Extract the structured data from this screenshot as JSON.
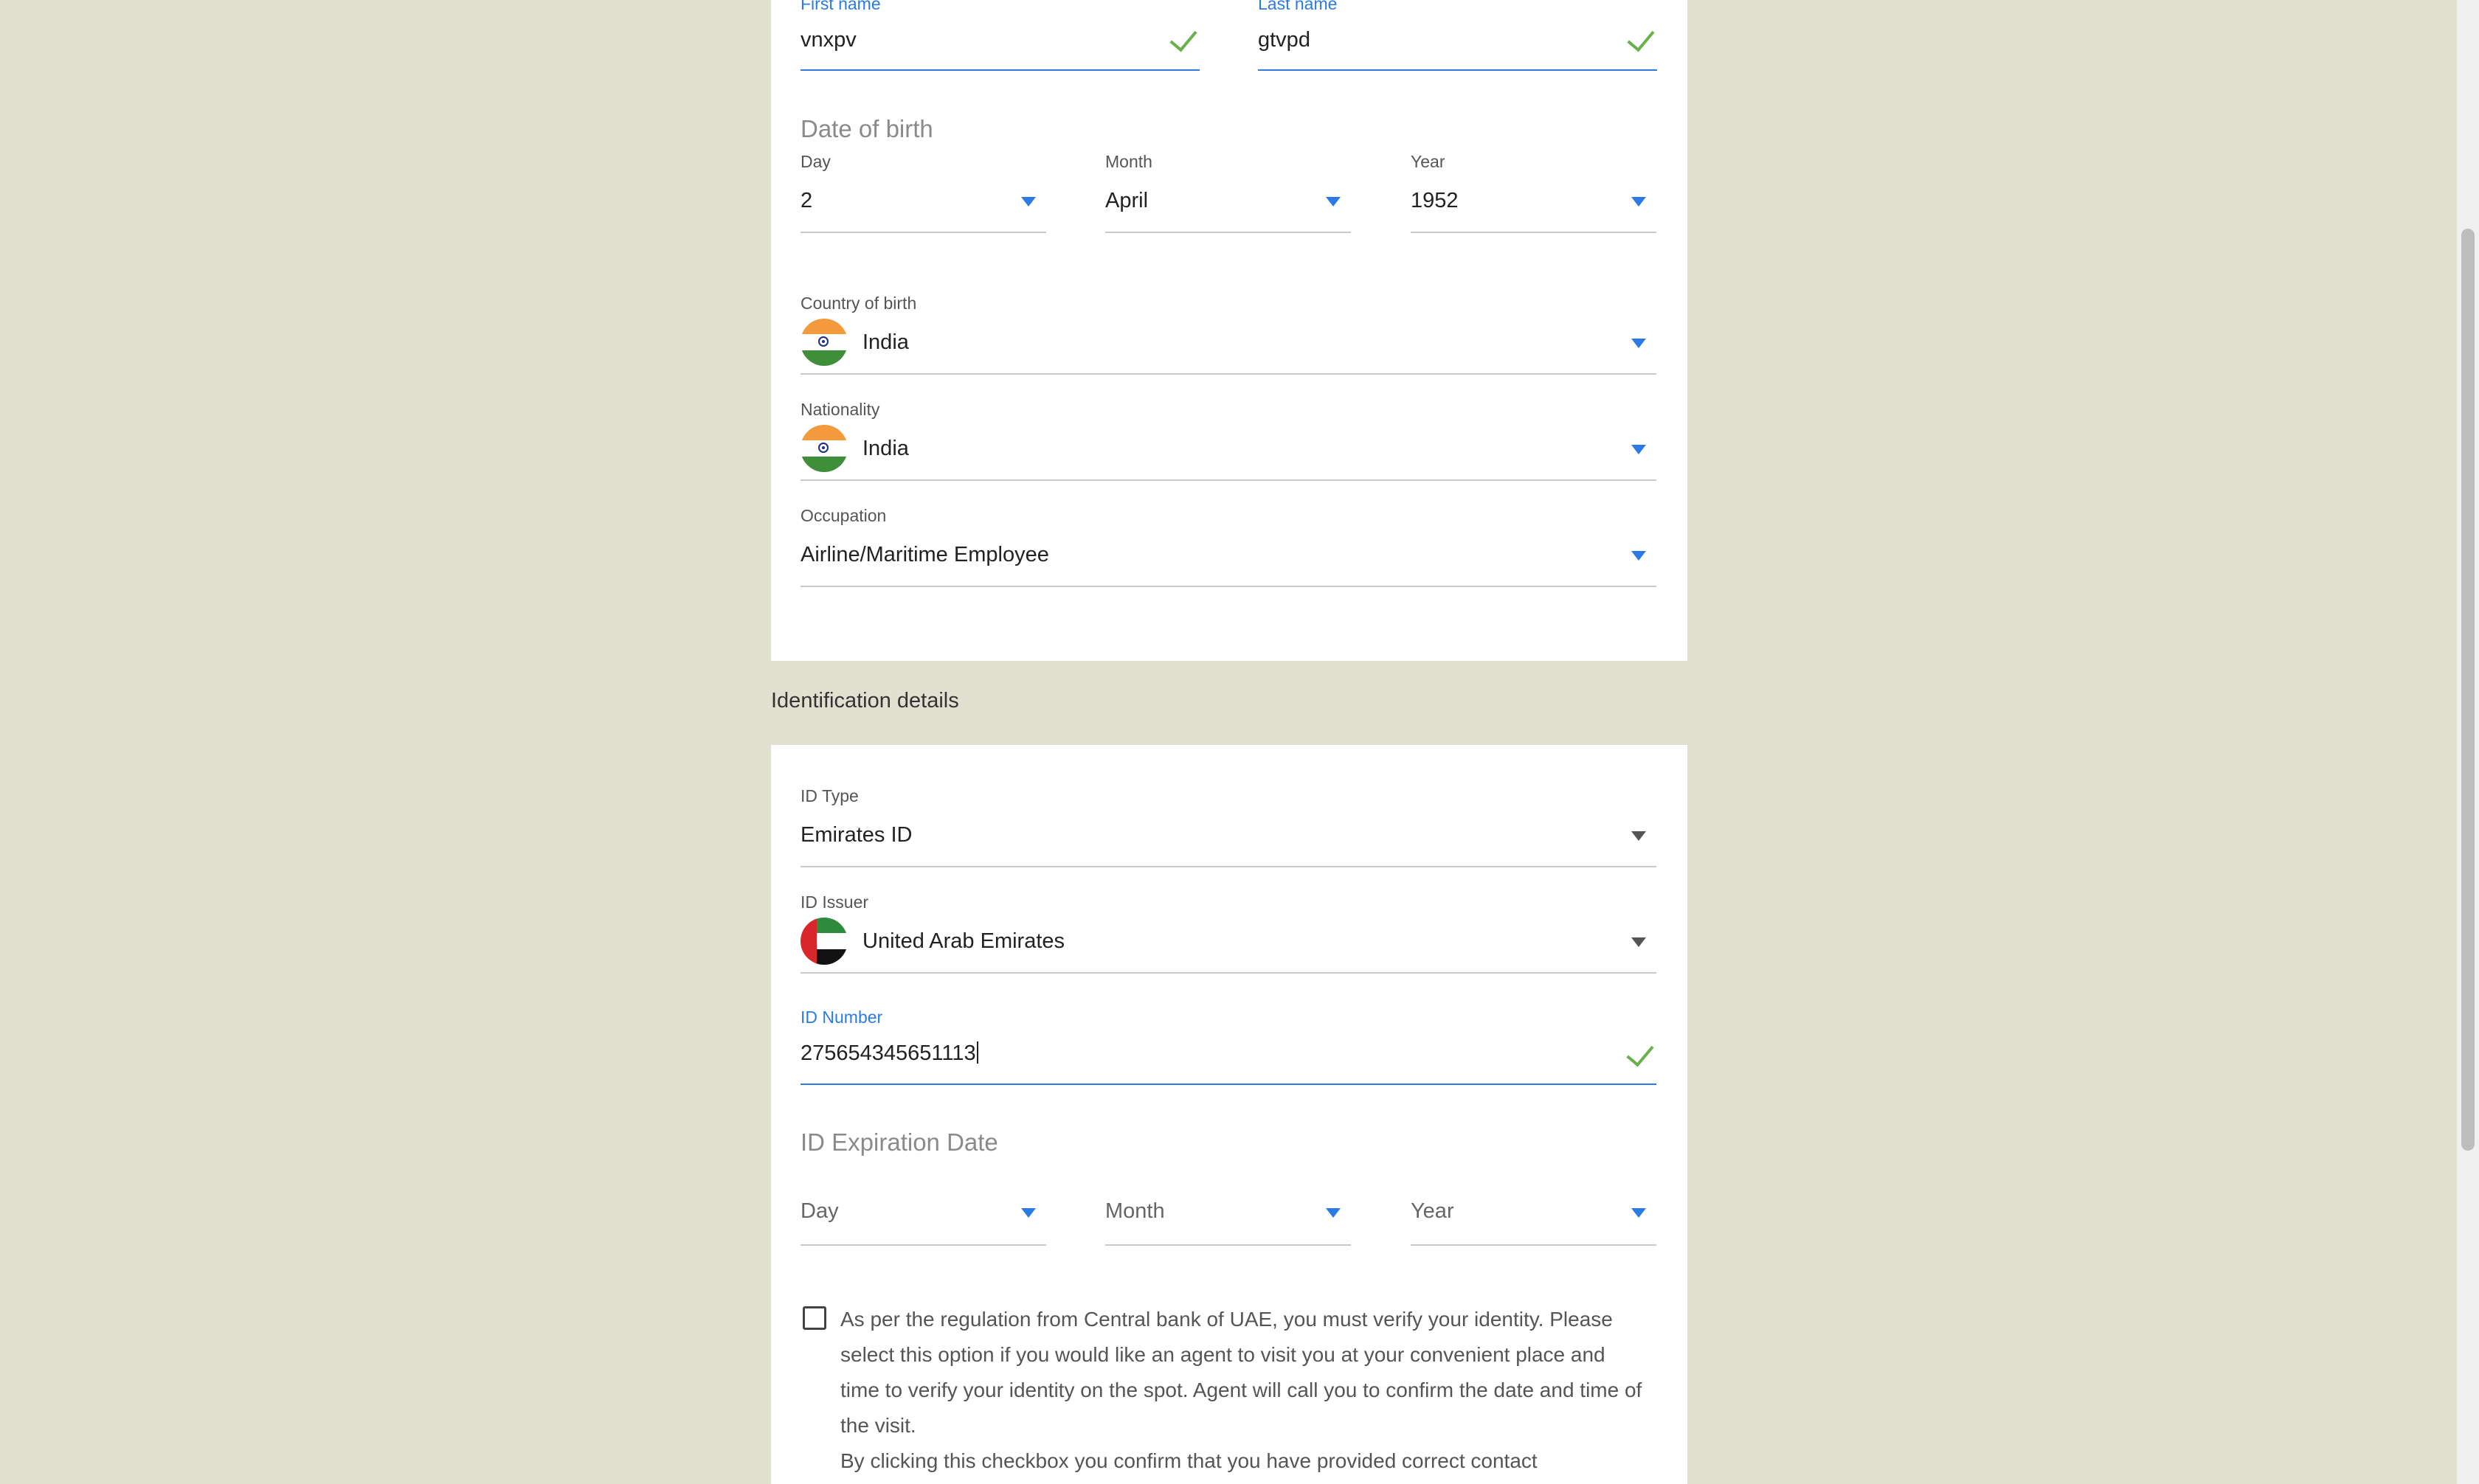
{
  "personal": {
    "first_name": {
      "label": "First name",
      "value": "vnxpv"
    },
    "last_name": {
      "label": "Last name",
      "value": "gtvpd"
    },
    "dob": {
      "title": "Date of birth",
      "day_label": "Day",
      "day_value": "2",
      "month_label": "Month",
      "month_value": "April",
      "year_label": "Year",
      "year_value": "1952"
    },
    "country_of_birth": {
      "label": "Country of birth",
      "value": "India",
      "flag_icon": "india-flag-icon"
    },
    "nationality": {
      "label": "Nationality",
      "value": "India",
      "flag_icon": "india-flag-icon"
    },
    "occupation": {
      "label": "Occupation",
      "value": "Airline/Maritime Employee"
    }
  },
  "identification": {
    "section_title": "Identification details",
    "id_type": {
      "label": "ID Type",
      "value": "Emirates ID"
    },
    "id_issuer": {
      "label": "ID Issuer",
      "value": "United Arab Emirates",
      "flag_icon": "uae-flag-icon"
    },
    "id_number": {
      "label": "ID Number",
      "value": "275654345651113"
    },
    "expiration": {
      "title": "ID Expiration Date",
      "day_placeholder": "Day",
      "month_placeholder": "Month",
      "year_placeholder": "Year"
    }
  },
  "consent": {
    "paragraph1": "As per the regulation from Central bank of UAE, you must verify your identity. Please select this option if you would like an agent to visit you at your convenient place and time to verify your identity on the spot. Agent will call you to confirm the date and time of the visit.",
    "paragraph2": "By clicking this checkbox you confirm that you have provided correct contact"
  },
  "colors": {
    "accent": "#2c7be5",
    "valid": "#6ab04c",
    "page_background": "#e2e0d0"
  }
}
